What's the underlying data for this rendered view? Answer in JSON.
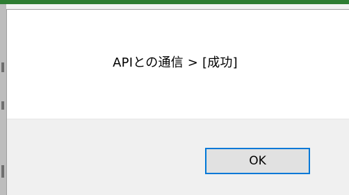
{
  "dialog": {
    "message": "APIとの通信 > [成功]",
    "ok_label": "OK"
  },
  "colors": {
    "background_top_strip": "#2e7d32",
    "dialog_body": "#ffffff",
    "dialog_footer": "#f0f0f0",
    "button_face": "#e1e1e1",
    "button_focus_border": "#0078d7"
  }
}
